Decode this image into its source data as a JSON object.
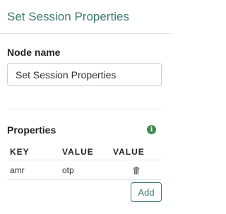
{
  "panel": {
    "title": "Set Session Properties"
  },
  "node_name": {
    "label": "Node name",
    "value": "Set Session Properties",
    "placeholder": ""
  },
  "properties": {
    "title": "Properties",
    "info_icon": "info-icon",
    "columns": [
      "KEY",
      "VALUE",
      "VALUE"
    ],
    "rows": [
      {
        "key": "amr",
        "value": "otp",
        "action_icon": "trash-icon"
      }
    ],
    "add_label": "Add"
  },
  "colors": {
    "accent": "#3d7a73",
    "info": "#3d8a4f"
  }
}
